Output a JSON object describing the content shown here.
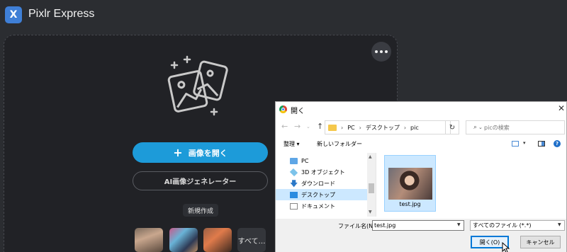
{
  "app": {
    "title": "Pixlr Express",
    "logo_letter": "X",
    "accent": "#1d9bd9"
  },
  "main": {
    "open_image_label": "画像を開く",
    "ai_generator_label": "AI画像ジェネレーター",
    "new_create_label": "新規作成",
    "see_all_label": "すべて…"
  },
  "dialog": {
    "title": "開く",
    "breadcrumb": [
      "PC",
      "デスクトップ",
      "pic"
    ],
    "search_placeholder": "picの検索",
    "organize_label": "整理 ▾",
    "new_folder_label": "新しいフォルダー",
    "nav_items": [
      {
        "label": "PC",
        "icon": "pc-icon"
      },
      {
        "label": "3D オブジェクト",
        "icon": "3d-objects-icon"
      },
      {
        "label": "ダウンロード",
        "icon": "download-icon"
      },
      {
        "label": "デスクトップ",
        "icon": "desktop-icon",
        "selected": true
      },
      {
        "label": "ドキュメント",
        "icon": "documents-icon"
      }
    ],
    "file": {
      "name": "test.jpg"
    },
    "filename_label": "ファイル名(N):",
    "filename_value": "test.jpg",
    "filetype_value": "すべてのファイル (*.*)",
    "open_button": "開く(O)",
    "cancel_button": "キャンセル"
  }
}
